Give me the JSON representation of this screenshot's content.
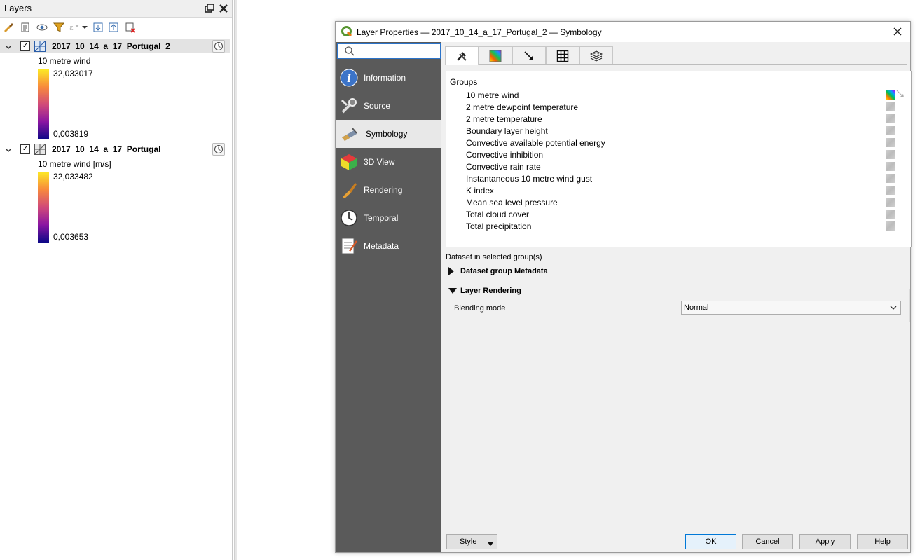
{
  "layers_panel": {
    "title": "Layers",
    "layers": [
      {
        "name": "2017_10_14_a_17_Portugal_2",
        "legend_title": "10 metre wind",
        "max": "32,033017",
        "min": "0,003819"
      },
      {
        "name": "2017_10_14_a_17_Portugal",
        "legend_title": "10 metre wind [m/s]",
        "max": "32,033482",
        "min": "0,003653"
      }
    ]
  },
  "dialog": {
    "title": "Layer Properties — 2017_10_14_a_17_Portugal_2 — Symbology",
    "search": {
      "value": "",
      "placeholder": ""
    },
    "sidebar": [
      {
        "label": "Information",
        "icon": "information-icon"
      },
      {
        "label": "Source",
        "icon": "source-icon"
      },
      {
        "label": "Symbology",
        "icon": "symbology-icon"
      },
      {
        "label": "3D View",
        "icon": "3d-view-icon"
      },
      {
        "label": "Rendering",
        "icon": "rendering-icon"
      },
      {
        "label": "Temporal",
        "icon": "temporal-icon"
      },
      {
        "label": "Metadata",
        "icon": "metadata-icon"
      }
    ],
    "active_sidebar": "Symbology",
    "tabs": [
      {
        "icon": "tools-icon"
      },
      {
        "icon": "color-ramp-icon"
      },
      {
        "icon": "vector-arrow-icon"
      },
      {
        "icon": "grid-mesh-icon"
      },
      {
        "icon": "layers-stack-icon"
      }
    ],
    "groups_label": "Groups",
    "groups": [
      "10 metre wind",
      "2 metre dewpoint temperature",
      "2 metre temperature",
      "Boundary layer height",
      "Convective available potential energy",
      "Convective inhibition",
      "Convective rain rate",
      "Instantaneous 10 metre wind gust",
      "K index",
      "Mean sea level pressure",
      "Total cloud cover",
      "Total precipitation"
    ],
    "dataset_label": "Dataset in selected group(s)",
    "metadata_section": "Dataset group Metadata",
    "rendering_section": "Layer Rendering",
    "blending_label": "Blending mode",
    "blending_value": "Normal",
    "buttons": {
      "style": "Style",
      "ok": "OK",
      "cancel": "Cancel",
      "apply": "Apply",
      "help": "Help"
    },
    "accent_color": "#0078d7",
    "sidebar_color": "#5a5a5a"
  }
}
